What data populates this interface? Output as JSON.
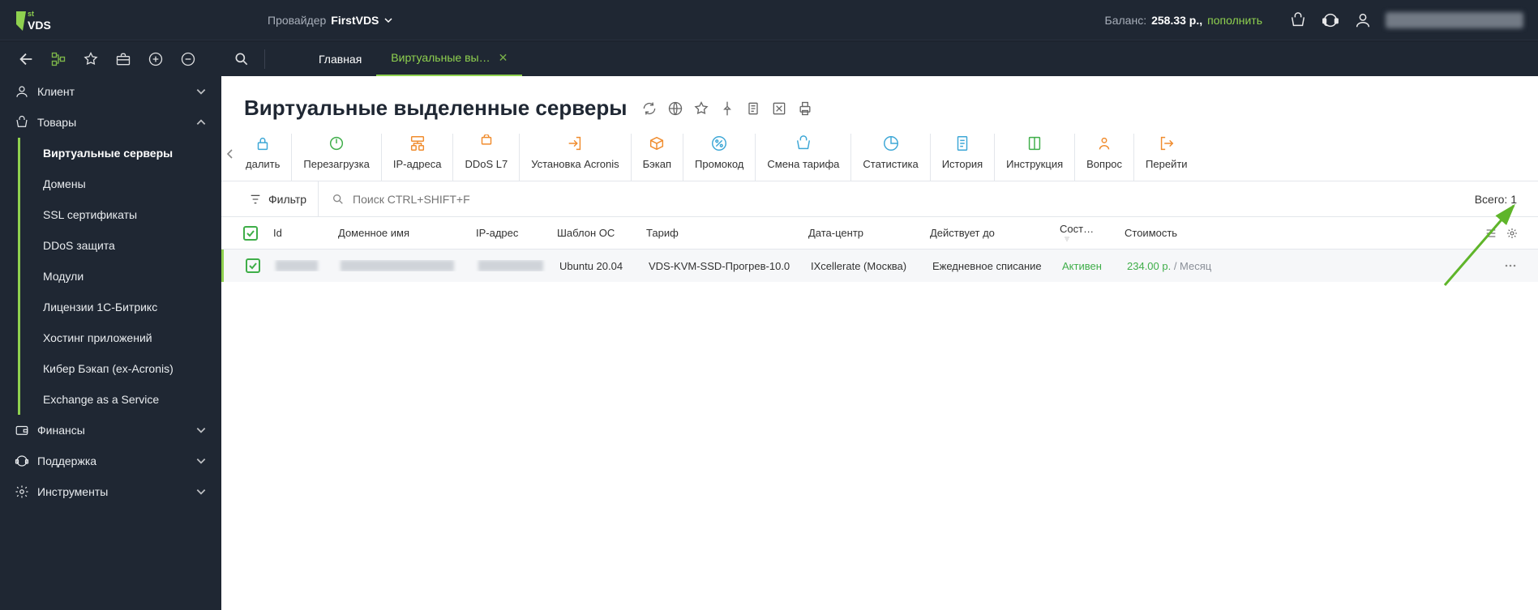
{
  "topbar": {
    "provider_label": "Провайдер",
    "provider_name": "FirstVDS",
    "balance_label": "Баланс:",
    "balance_value": "258.33 р.,",
    "balance_topup": "пополнить"
  },
  "tabs": [
    {
      "label": "Главная",
      "active": false
    },
    {
      "label": "Виртуальные вы…",
      "active": true,
      "closable": true
    }
  ],
  "sidebar": {
    "sections": [
      {
        "key": "client",
        "label": "Клиент",
        "expanded": false
      },
      {
        "key": "products",
        "label": "Товары",
        "expanded": true,
        "items": [
          {
            "key": "vds",
            "label": "Виртуальные серверы",
            "selected": true
          },
          {
            "key": "domains",
            "label": "Домены"
          },
          {
            "key": "ssl",
            "label": "SSL сертификаты"
          },
          {
            "key": "ddos",
            "label": "DDoS защита"
          },
          {
            "key": "modules",
            "label": "Модули"
          },
          {
            "key": "bitrix",
            "label": "Лицензии 1С-Битрикс"
          },
          {
            "key": "apphost",
            "label": "Хостинг приложений"
          },
          {
            "key": "cyber",
            "label": "Кибер Бэкап (ex-Acronis)"
          },
          {
            "key": "exchange",
            "label": "Exchange as a Service"
          }
        ]
      },
      {
        "key": "finance",
        "label": "Финансы",
        "expanded": false
      },
      {
        "key": "support",
        "label": "Поддержка",
        "expanded": false
      },
      {
        "key": "tools",
        "label": "Инструменты",
        "expanded": false
      }
    ]
  },
  "page": {
    "title": "Виртуальные выделенные серверы",
    "filter_label": "Фильтр",
    "search_placeholder": "Поиск CTRL+SHIFT+F",
    "total_label": "Всего:",
    "total_value": "1"
  },
  "toolbar": [
    {
      "key": "delete",
      "label": "далить",
      "icon": "lock",
      "color": "#3da7d6"
    },
    {
      "key": "reboot",
      "label": "Перезагрузка",
      "icon": "power",
      "color": "#3fae49"
    },
    {
      "key": "ips",
      "label": "IP-адреса",
      "icon": "network",
      "color": "#f08c2e"
    },
    {
      "key": "ddos",
      "label": "DDoS L7",
      "icon": "shield",
      "color": "#f08c2e"
    },
    {
      "key": "acronis",
      "label": "Установка Acronis",
      "icon": "login",
      "color": "#f08c2e"
    },
    {
      "key": "backup",
      "label": "Бэкап",
      "icon": "package",
      "color": "#f08c2e"
    },
    {
      "key": "promo",
      "label": "Промокод",
      "icon": "percent",
      "color": "#3da7d6"
    },
    {
      "key": "tariff",
      "label": "Смена тарифа",
      "icon": "basket",
      "color": "#3da7d6"
    },
    {
      "key": "stats",
      "label": "Статистика",
      "icon": "pie",
      "color": "#3da7d6"
    },
    {
      "key": "history",
      "label": "История",
      "icon": "page",
      "color": "#3da7d6"
    },
    {
      "key": "manual",
      "label": "Инструкция",
      "icon": "book",
      "color": "#3fae49"
    },
    {
      "key": "question",
      "label": "Вопрос",
      "icon": "person",
      "color": "#f08c2e"
    },
    {
      "key": "go",
      "label": "Перейти",
      "icon": "exit",
      "color": "#f08c2e"
    }
  ],
  "columns": {
    "id": "Id",
    "domain": "Доменное имя",
    "ip": "IP-адрес",
    "os": "Шаблон ОС",
    "tariff": "Тариф",
    "dc": "Дата-центр",
    "until": "Действует до",
    "state": "Сост…",
    "cost": "Стоимость"
  },
  "rows": [
    {
      "os": "Ubuntu 20.04",
      "tariff": "VDS-KVM-SSD-Прогрев-10.0",
      "dc": "IXcellerate (Москва)",
      "until": "Ежедневное списание",
      "state": "Активен",
      "cost_value": "234.00 р.",
      "cost_period": " / Месяц"
    }
  ],
  "colors": {
    "accent": "#8fd14f",
    "dark": "#1f2733",
    "orange": "#f08c2e",
    "blue": "#3da7d6",
    "green": "#3fae49"
  }
}
